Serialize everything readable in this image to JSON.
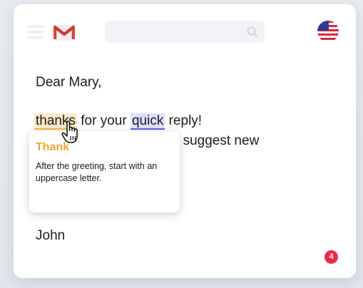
{
  "email": {
    "greeting": "Dear Mary,",
    "line1": {
      "word_highlight_1": "thanks",
      "mid": " for your ",
      "word_highlight_2": "quick",
      "end": " reply!"
    },
    "line2_visible_fragment": ") suggest new",
    "signature": "John"
  },
  "tooltip": {
    "title": "Thank",
    "body": "After the greeting, start with an uppercase letter."
  },
  "badge": {
    "count": "4",
    "color": "#ea2d4b"
  },
  "colors": {
    "highlight_warning": "#f2b136",
    "highlight_info": "#5b5cf0",
    "tooltip_title": "#f2a53a"
  },
  "icons": {
    "menu": "hamburger-menu-icon",
    "logo": "gmail-logo-icon",
    "search": "search-icon",
    "language": "us-flag-icon",
    "cursor": "hand-pointer-icon"
  }
}
